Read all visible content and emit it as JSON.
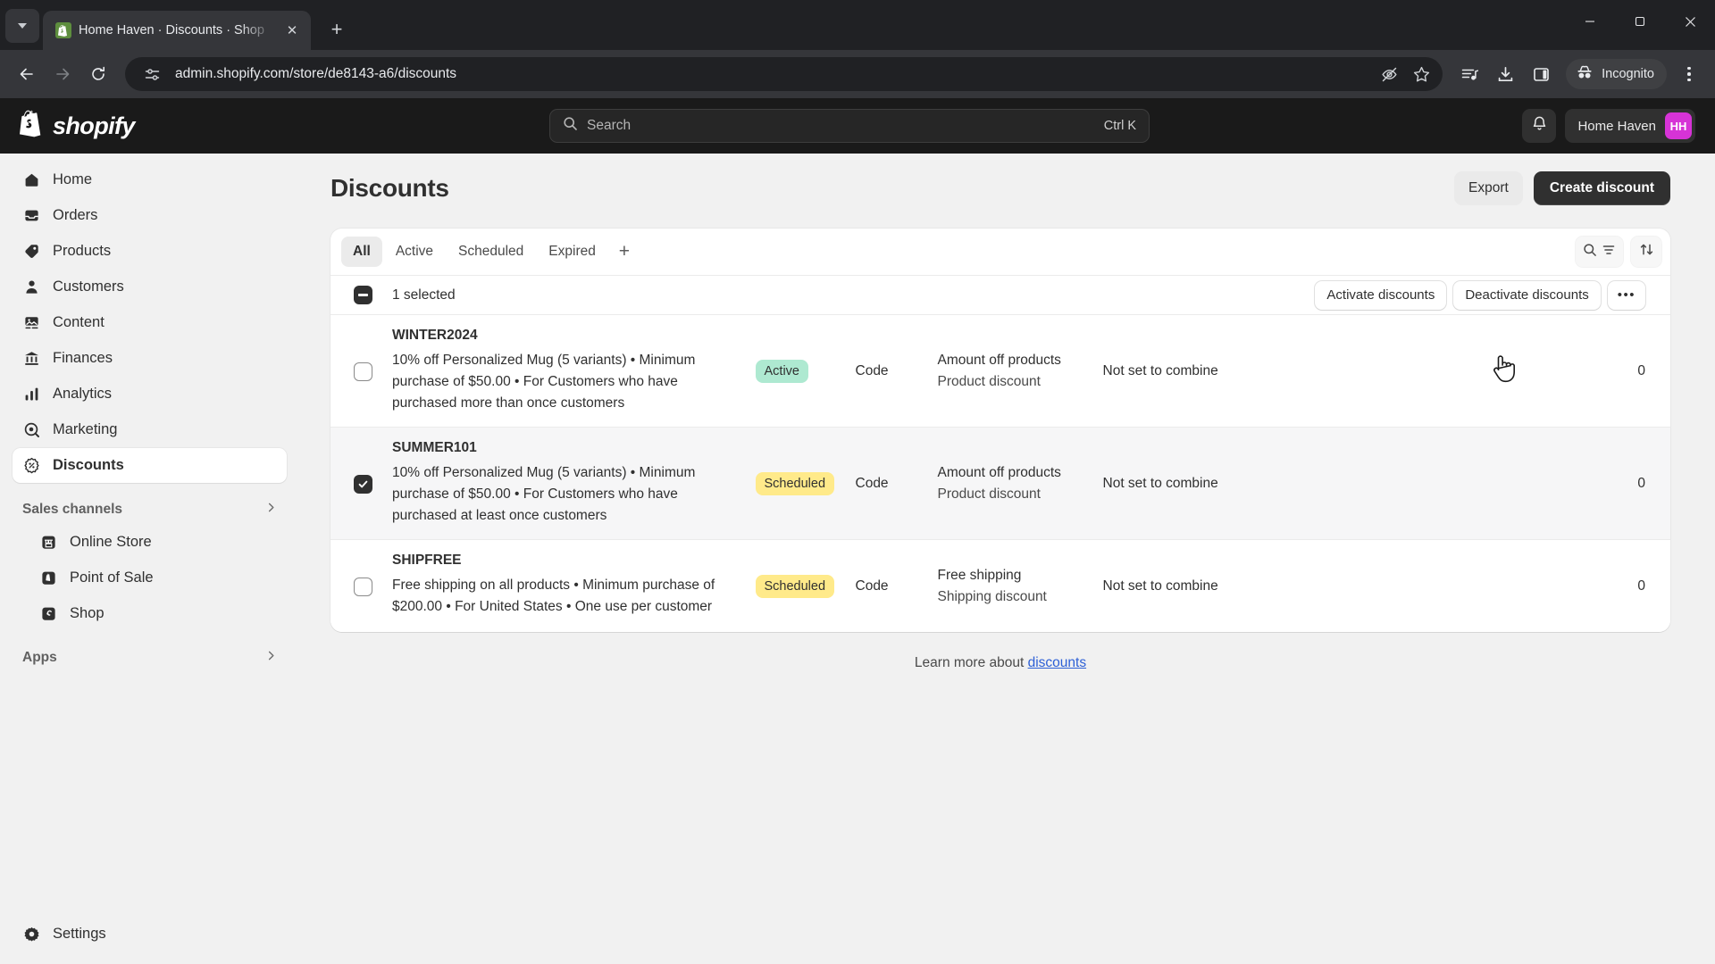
{
  "browser": {
    "tab": {
      "title": "Home Haven · Discounts · Shop",
      "favicon": "shopify-favicon",
      "close_label": "✕"
    },
    "new_tab_label": "+",
    "tab_list_label": "⌄",
    "url": "admin.shopify.com/store/de8143-a6/discounts",
    "profile_label": "Incognito",
    "icons": {
      "back": "back-arrow-icon",
      "forward": "forward-arrow-icon",
      "reload": "reload-icon",
      "site_info": "site-settings-icon",
      "eye_off": "hide-password-icon",
      "bookmark": "star-icon",
      "reading_list": "playlist-icon",
      "downloads": "download-icon",
      "side_panel": "split-panel-icon",
      "menu": "kebab-menu-icon",
      "minimize": "minimize-icon",
      "maximize": "maximize-icon",
      "close": "window-close-icon"
    }
  },
  "topbar": {
    "brand": "shopify",
    "search": {
      "placeholder": "Search",
      "shortcut": "Ctrl K"
    },
    "store_name": "Home Haven",
    "avatar_initials": "HH",
    "avatar_color": "#d633d6"
  },
  "sidebar": {
    "items": [
      {
        "label": "Home",
        "icon": "home-icon"
      },
      {
        "label": "Orders",
        "icon": "orders-inbox-icon"
      },
      {
        "label": "Products",
        "icon": "tag-icon"
      },
      {
        "label": "Customers",
        "icon": "person-icon"
      },
      {
        "label": "Content",
        "icon": "image-icon"
      },
      {
        "label": "Finances",
        "icon": "bank-icon"
      },
      {
        "label": "Analytics",
        "icon": "bar-chart-icon"
      },
      {
        "label": "Marketing",
        "icon": "megaphone-target-icon"
      },
      {
        "label": "Discounts",
        "icon": "discount-percent-icon",
        "active": true
      }
    ],
    "sections": [
      {
        "label": "Sales channels",
        "chevron": "chevron-right-icon",
        "items": [
          {
            "label": "Online Store",
            "icon": "storefront-icon"
          },
          {
            "label": "Point of Sale",
            "icon": "pos-icon"
          },
          {
            "label": "Shop",
            "icon": "shop-app-icon"
          }
        ]
      },
      {
        "label": "Apps",
        "chevron": "chevron-right-icon",
        "items": []
      }
    ],
    "settings": {
      "label": "Settings",
      "icon": "gear-icon"
    }
  },
  "page": {
    "title": "Discounts",
    "export_label": "Export",
    "create_label": "Create discount",
    "learn_more_prefix": "Learn more about",
    "learn_more_link": "discounts"
  },
  "tabs": {
    "items": [
      {
        "label": "All",
        "selected": true
      },
      {
        "label": "Active",
        "selected": false
      },
      {
        "label": "Scheduled",
        "selected": false
      },
      {
        "label": "Expired",
        "selected": false
      }
    ],
    "add_label": "+",
    "search_icon": "search-filter-icon",
    "sort_icon": "sort-arrows-icon"
  },
  "selection_bar": {
    "checkbox_state": "indeterminate",
    "label": "1 selected",
    "activate_label": "Activate discounts",
    "deactivate_label": "Deactivate discounts",
    "more_label": "•••"
  },
  "table": {
    "rows": [
      {
        "code": "WINTER2024",
        "description": "10% off Personalized Mug (5 variants) • Minimum purchase of $50.00 • For Customers who have purchased more than once customers",
        "status": "Active",
        "status_tone": "active",
        "method": "Code",
        "type": "Amount off products",
        "type_sub": "Product discount",
        "combinations": "Not set to combine",
        "used": "0",
        "checked": false
      },
      {
        "code": "SUMMER101",
        "description": "10% off Personalized Mug (5 variants) • Minimum purchase of $50.00 • For Customers who have purchased at least once customers",
        "status": "Scheduled",
        "status_tone": "scheduled",
        "method": "Code",
        "type": "Amount off products",
        "type_sub": "Product discount",
        "combinations": "Not set to combine",
        "used": "0",
        "checked": true
      },
      {
        "code": "SHIPFREE",
        "description": "Free shipping on all products • Minimum purchase of $200.00 • For United States • One use per customer",
        "status": "Scheduled",
        "status_tone": "scheduled",
        "method": "Code",
        "type": "Free shipping",
        "type_sub": "Shipping discount",
        "combinations": "Not set to combine",
        "used": "0",
        "checked": false
      }
    ]
  },
  "colors": {
    "brand_dark": "#1a1a1a",
    "page_bg": "#f1f1f1",
    "accent_link": "#2c5fd6",
    "badge_active": "#aee9d1",
    "badge_scheduled": "#ffea8a"
  }
}
